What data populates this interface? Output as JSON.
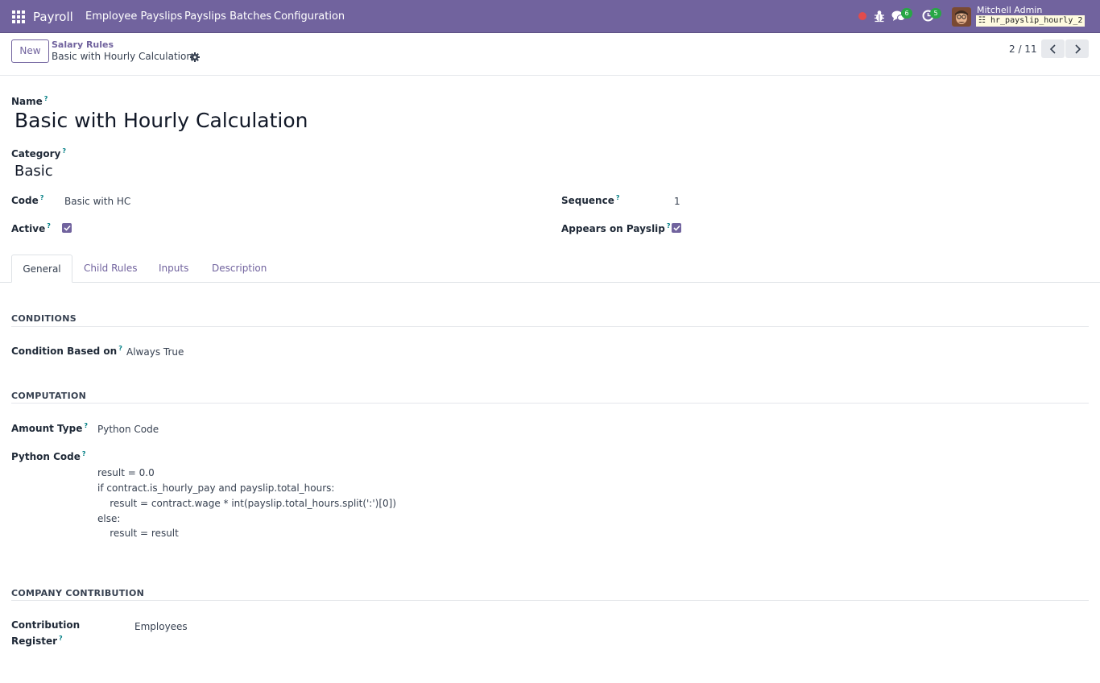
{
  "navbar": {
    "brand": "Payroll",
    "menu": [
      "Employee Payslips",
      "Payslips Batches",
      "Configuration"
    ],
    "messages_count": "6",
    "activities_count": "5",
    "user_name": "Mitchell Admin",
    "database": "hr_payslip_hourly_2"
  },
  "control": {
    "new_label": "New",
    "breadcrumb_parent": "Salary Rules",
    "breadcrumb_current": "Basic with Hourly Calculation",
    "pager": "2 / 11"
  },
  "form": {
    "name_label": "Name",
    "name_value": "Basic with Hourly Calculation",
    "category_label": "Category",
    "category_value": "Basic",
    "code_label": "Code",
    "code_value": "Basic with HC",
    "sequence_label": "Sequence",
    "sequence_value": "1",
    "active_label": "Active",
    "active_checked": true,
    "appears_label": "Appears on Payslip",
    "appears_checked": true,
    "help_mark": "?"
  },
  "tabs": [
    "General",
    "Child Rules",
    "Inputs",
    "Description"
  ],
  "general": {
    "conditions_title": "CONDITIONS",
    "condition_label": "Condition Based on",
    "condition_value": "Always True",
    "computation_title": "COMPUTATION",
    "amount_type_label": "Amount Type",
    "amount_type_value": "Python Code",
    "python_code_label": "Python Code",
    "python_code_lines": [
      "result = 0.0",
      "if contract.is_hourly_pay and payslip.total_hours:",
      "    result = contract.wage * int(payslip.total_hours.split(':')[0])",
      "else:",
      "    result = result"
    ],
    "company_title": "COMPANY CONTRIBUTION",
    "contribution_label_1": "Contribution",
    "contribution_label_2": "Register",
    "contribution_value": "Employees"
  },
  "colors": {
    "brand": "#71639e",
    "badge": "#28a745",
    "help": "#017e84"
  },
  "icons": [
    "apps-icon",
    "bug-icon",
    "chat-icon",
    "activity-clock-icon",
    "gear-icon",
    "chevron-left-icon",
    "chevron-right-icon",
    "check-icon"
  ]
}
